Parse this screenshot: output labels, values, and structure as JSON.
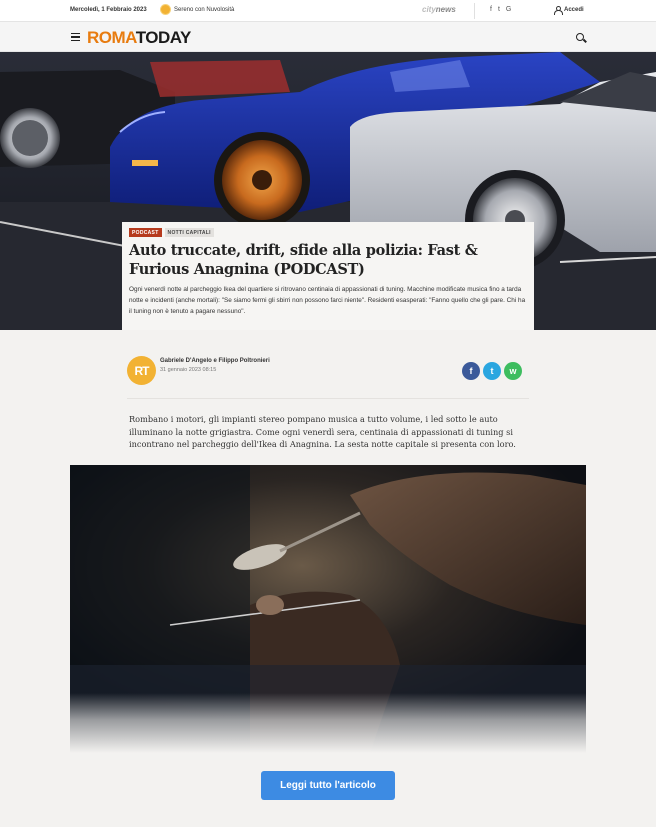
{
  "topbar": {
    "date": "Mercoledì, 1 Febbraio 2023",
    "weather_icon": "sun-icon",
    "weather_text": "Sereno con Nuvolosità",
    "network_brand_prefix": "city",
    "network_brand_suffix": "news",
    "social_icons": [
      "facebook-icon",
      "twitter-icon",
      "google-icon"
    ],
    "login_label": "Accedi"
  },
  "header": {
    "logo_part1": "ROMA",
    "logo_part2": "TODAY",
    "logo_color": "#e87c10"
  },
  "article": {
    "tags": [
      "PODCAST",
      "NOTTI CAPITALI"
    ],
    "title": "Auto truccate, drift, sfide alla polizia: Fast & Furious Anagnina (PODCAST)",
    "summary": "Ogni venerdì notte al parcheggio Ikea del quartiere si ritrovano centinaia di appassionati di tuning. Macchine modificate musica fino a tarda notte e incidenti (anche mortali): \"Se siamo fermi gli sbirri non possono farci niente\". Residenti esasperati: \"Fanno quello che gli pare. Chi ha il tuning non è tenuto a pagare nessuno\".",
    "author_initials": "RT",
    "author": "Gabriele D'Angelo e Filippo Poltronieri",
    "date": "31 gennaio 2023 08:15",
    "share_icons": [
      "facebook-icon",
      "twitter-icon",
      "whatsapp-icon"
    ],
    "intro": "Rombano i motori, gli impianti stereo pompano musica a tutto volume, i led sotto le auto illuminano la notte grigiastra. Come ogni venerdì sera, centinaia di appassionati di tuning si incontrano nel parcheggio dell'Ikea di Anagnina. La sesta notte capitale si presenta con loro.",
    "read_more_label": "Leggi tutto l'articolo"
  }
}
